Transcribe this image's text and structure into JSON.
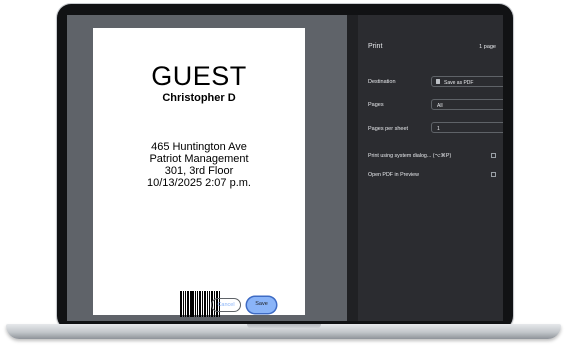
{
  "badge": {
    "title": "GUEST",
    "name": "Christopher D",
    "address_line1": "465 Huntington Ave",
    "address_line2": "Patriot Management",
    "address_line3": "301, 3rd Floor",
    "datetime": "10/13/2025 2:07 p.m."
  },
  "print_dialog": {
    "title": "Print",
    "page_count": "1 page",
    "destination": {
      "label": "Destination",
      "value": "Save as PDF",
      "icon": "document-icon"
    },
    "pages": {
      "label": "Pages",
      "value": "All"
    },
    "pages_per_sheet": {
      "label": "Pages per sheet",
      "value": "1"
    },
    "system_dialog_link": "Print using system dialog... (⌥⌘P)",
    "open_pdf_link": "Open PDF in Preview",
    "cancel_label": "Cancel",
    "save_label": "Save"
  },
  "colors": {
    "dialog_bg": "#2b2c30",
    "preview_bg": "#5f6369",
    "accent": "#8ab4f8"
  }
}
